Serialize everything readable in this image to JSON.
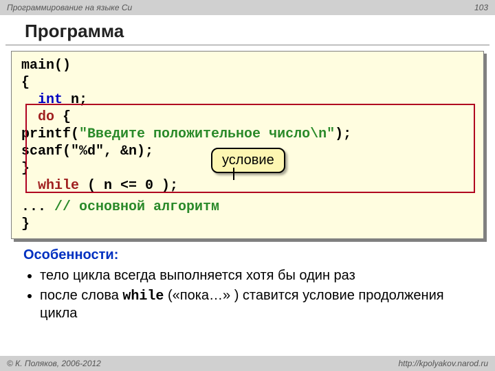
{
  "topbar": {
    "course_title": "Программирование на языке Си",
    "page_number": "103"
  },
  "title": "Программа",
  "code": {
    "l1_main": "main()",
    "l2_brace": "{",
    "l3_int": "int",
    "l3_rest": " n;",
    "l4_do": "do",
    "l4_rest": " {",
    "l5_printf": "    printf(",
    "l5_str": "\"Введите положительное число\\n\"",
    "l5_end": ");",
    "l6": "    scanf(\"%d\", &n);",
    "l7": "    }",
    "l8_while": "while",
    "l8_rest": " ( n <= 0 );",
    "l9_dots": "  ... ",
    "l9_comment": "// основной алгоритм",
    "l10_brace": "}"
  },
  "callout": "условие",
  "features": {
    "heading": "Особенности:",
    "items": [
      "тело цикла всегда выполняется хотя бы один раз",
      "после слова ",
      "while",
      " («пока…» ) ставится условие продолжения цикла"
    ]
  },
  "footer": {
    "left": "© К. Поляков, 2006-2012",
    "right": "http://kpolyakov.narod.ru"
  }
}
